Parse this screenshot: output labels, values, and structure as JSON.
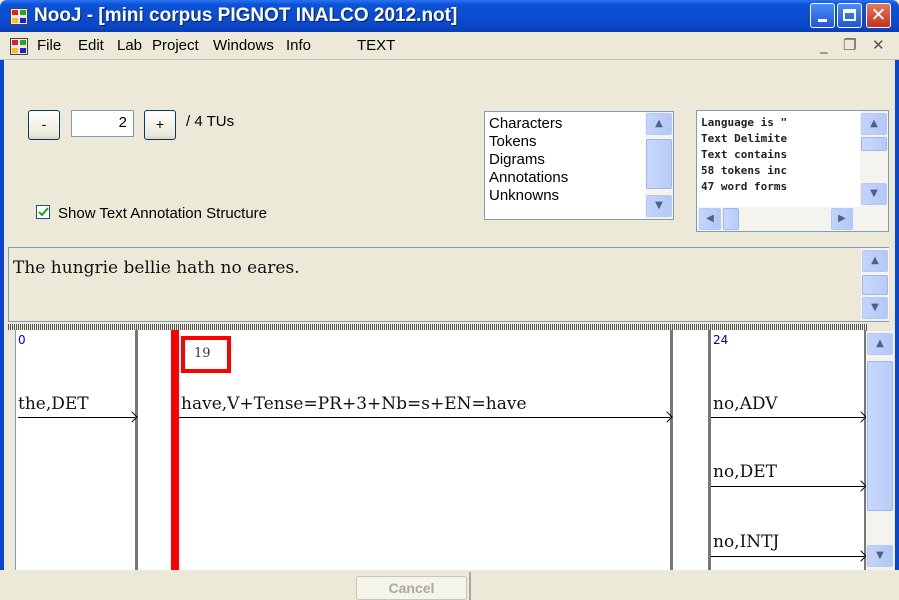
{
  "window": {
    "title": "NooJ - [mini corpus PIGNOT INALCO 2012.not]",
    "close_glyph": "✕"
  },
  "menu": {
    "items": [
      "File",
      "Edit",
      "Lab",
      "Project",
      "Windows",
      "Info",
      "TEXT"
    ],
    "mdi_min": "_",
    "mdi_restore": "❐",
    "mdi_close": "✕"
  },
  "navigator": {
    "minus_label": "-",
    "current_value": "2",
    "plus_label": "+",
    "total_label": "/ 4 TUs"
  },
  "show_structure": {
    "label": "Show Text Annotation Structure",
    "checked": true
  },
  "stats_list": [
    "Characters",
    "Tokens",
    "Digrams",
    "Annotations",
    "Unknowns"
  ],
  "info_lines": [
    "Language is \"",
    "Text Delimite",
    "Text contains",
    "58 tokens inc",
    "47 word forms"
  ],
  "text_unit": "The hungrie bellie hath no eares.",
  "annotations": {
    "col1_offset": "0",
    "col1_label": "the,DET",
    "col2_offset": "19",
    "col2_label": "have,V+Tense=PR+3+Nb=s+EN=have",
    "col3_offset": "24",
    "col3_labels": [
      "no,ADV",
      "no,DET",
      "no,INTJ"
    ]
  },
  "status": {
    "cancel_label": "Cancel"
  },
  "colors": {
    "titlebar": "#0a52d8",
    "highlight": "#ff0000",
    "offset_number": "#0000cc"
  }
}
